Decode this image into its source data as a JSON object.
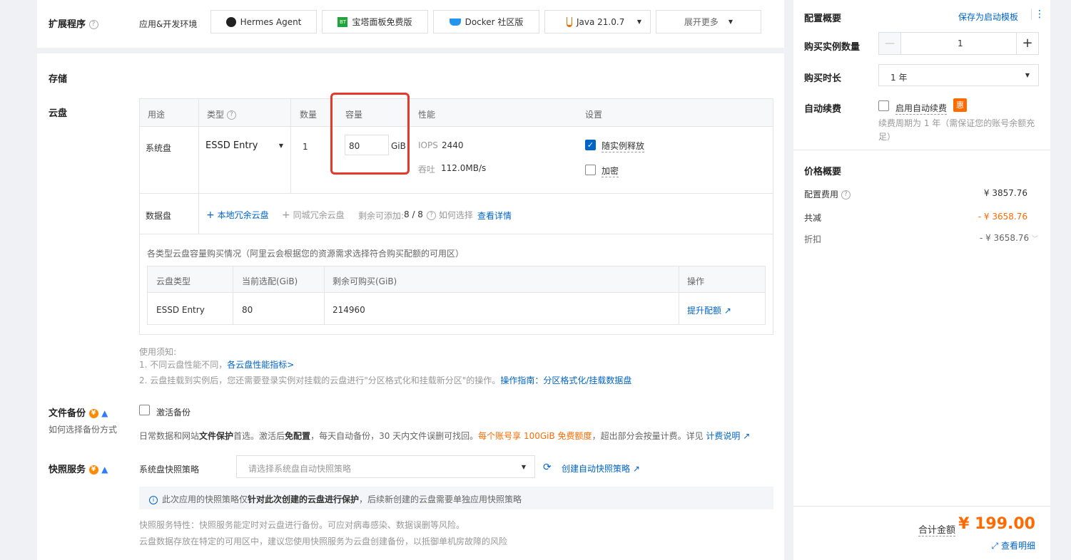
{
  "extensions": {
    "title": "扩展程序",
    "subtitle": "应用&开发环境",
    "apps": [
      {
        "label": "Hermes Agent",
        "icon": "hermes-icon"
      },
      {
        "label": "宝塔面板免费版",
        "icon": "bt-panel-icon",
        "icon_text": "BT"
      },
      {
        "label": "Docker 社区版",
        "icon": "docker-icon"
      },
      {
        "label": "Java 21.0.7",
        "icon": "java-icon"
      }
    ],
    "expand_label": "展开更多"
  },
  "storage": {
    "title": "存储",
    "cloud_disk_label": "云盘",
    "headers": {
      "usage": "用途",
      "type": "类型",
      "count": "数量",
      "capacity": "容量",
      "performance": "性能",
      "settings": "设置"
    },
    "system_disk": {
      "usage": "系统盘",
      "type": "ESSD Entry",
      "count": "1",
      "capacity": "80",
      "unit": "GiB",
      "iops_label": "IOPS",
      "iops": "2440",
      "throughput_label": "吞吐",
      "throughput": "112.0MB/s",
      "release_label": "随实例释放",
      "release_checked": true,
      "encrypt_label": "加密",
      "encrypt_checked": false
    },
    "data_disk": {
      "label": "数据盘",
      "add_local": "本地冗余云盘",
      "add_zone": "同城冗余云盘",
      "remaining_label": "剩余可添加:",
      "remaining": "8 / 8",
      "how_choose": "如何选择",
      "view_detail": "查看详情"
    },
    "quota": {
      "caption": "各类型云盘容量购买情况（阿里云会根据您的资源需求选择符合购买配额的可用区）",
      "headers": [
        "云盘类型",
        "当前选配(GiB)",
        "剩余可购买(GiB)",
        "操作"
      ],
      "rows": [
        {
          "type": "ESSD Entry",
          "current": "80",
          "remaining": "214960",
          "action": "提升配额"
        }
      ]
    },
    "notes": {
      "title": "使用须知:",
      "line1": "1. 不同云盘性能不同，",
      "line1_link": "各云盘性能指标>",
      "line2": "2. 云盘挂载到实例后，您还需要登录实例对挂载的云盘进行\"分区格式化和挂载新分区\"的操作。",
      "line2_link": "操作指南：分区格式化/挂载数据盘"
    }
  },
  "backup": {
    "title": "文件备份",
    "sub": "如何选择备份方式",
    "activate_label": "激活备份",
    "desc_a": "日常数据和网站",
    "desc_b": "文件保护",
    "desc_c": "首选。激活后",
    "desc_d": "免配置",
    "desc_e": "，每天自动备份，30 天内文件误删可找回。",
    "desc_f": "每个账号享 100GiB 免费额度",
    "desc_g": "，超出部分会按量计费。详见",
    "desc_link": "计费说明"
  },
  "snapshot": {
    "title": "快照服务",
    "policy_label": "系统盘快照策略",
    "policy_placeholder": "请选择系统盘自动快照策略",
    "create_link": "创建自动快照策略",
    "info_a": "此次应用的快照策略仅",
    "info_b": "针对此次创建的云盘进行保护",
    "info_c": "，后续新创建的云盘需要单独应用快照策略",
    "feature": "快照服务特性：快照服务能定时对云盘进行备份。可应对病毒感染、数据误删等风险。",
    "advice": "云盘数据存放在特定的可用区中，建议您使用快照服务为云盘创建备份，以抵御单机房故障的风险"
  },
  "sidebar": {
    "title": "配置概要",
    "save_template": "保存为启动模板",
    "qty_label": "购买实例数量",
    "qty_value": "1",
    "duration_label": "购买时长",
    "duration_value": "1 年",
    "autorenew_label": "自动续费",
    "autorenew_option": "启用自动续费",
    "autorenew_badge": "惠",
    "autorenew_note": "续费周期为 1 年（需保证您的账号余额充足）",
    "price_title": "价格概要",
    "config_fee_label": "配置费用",
    "config_fee": "¥ 3857.76",
    "reduce_label": "共减",
    "reduce": "- ¥ 3658.76",
    "discount_label": "折扣",
    "discount": "- ¥ 3658.76",
    "total_label": "合计金额",
    "total": "¥ 199.00",
    "view_detail": "查看明细"
  },
  "colors": {
    "accent": "#0064c8",
    "orange": "#ff6a00",
    "highlight": "#e5392a"
  }
}
